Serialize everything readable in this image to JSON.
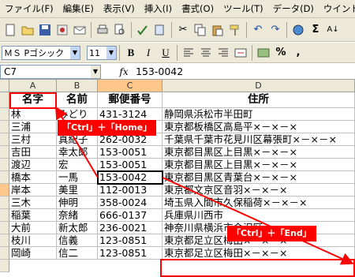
{
  "menu": [
    "ファイル(F)",
    "編集(E)",
    "表示(V)",
    "挿入(I)",
    "書式(O)",
    "ツール(T)",
    "データ(D)",
    "ウインドウ"
  ],
  "toolbar_icons": [
    "new-icon",
    "open-icon",
    "save-icon",
    "permission-icon",
    "email-icon",
    "print-icon",
    "print-preview-icon",
    "spell-check-icon",
    "research-icon",
    "cut-icon",
    "copy-icon",
    "paste-icon",
    "format-painter-icon",
    "undo-icon",
    "redo-icon",
    "hyperlink-icon",
    "autosum-icon",
    "sort-icon"
  ],
  "format": {
    "font": "ＭＳ Pゴシック",
    "size": "11",
    "bold": "B",
    "italic": "I",
    "underline": "U"
  },
  "formula": {
    "name_box": "C7",
    "fx": "fx",
    "value": "153-0042"
  },
  "columns": [
    "A",
    "B",
    "C",
    "D"
  ],
  "headers": [
    "名字",
    "名前",
    "郵便番号",
    "住所"
  ],
  "rows": [
    [
      "林",
      "みどり",
      "431-3124",
      "静岡県浜松市半田町"
    ],
    [
      "三浦",
      "正明",
      "174-0062",
      "東京都板橋区高島平×－×－×"
    ],
    [
      "三村",
      "真紀子",
      "262-0032",
      "千葉県千葉市花見川区幕張町×－×－×"
    ],
    [
      "吉田",
      "幸太郎",
      "153-0051",
      "東京都目黒区上目黒×－×－×"
    ],
    [
      "渡辺",
      "宏",
      "153-0051",
      "東京都目黒区上目黒×－×－×"
    ],
    [
      "橋本",
      "一馬",
      "153-0042",
      "東京都目黒区青葉台×－×－×"
    ],
    [
      "岸本",
      "美里",
      "112-0013",
      "東京都文京区音羽×－×－×"
    ],
    [
      "三木",
      "伸明",
      "358-0024",
      "埼玉県入間市久保稲荷×－×－×"
    ],
    [
      "稲葉",
      "奈緒",
      "666-0137",
      "兵庫県川西市"
    ],
    [
      "大前",
      "新太郎",
      "236-0021",
      "神奈川県横浜市金沢区"
    ],
    [
      "枝川",
      "信義",
      "123-0851",
      "東京都足立区梅田×－×－×"
    ],
    [
      "岡崎",
      "信二",
      "123-0851",
      "東京都足立区梅田×－×－×"
    ]
  ],
  "callouts": {
    "home": "「Ctrl」＋「Home」",
    "end": "「Ctrl」＋「End」"
  }
}
